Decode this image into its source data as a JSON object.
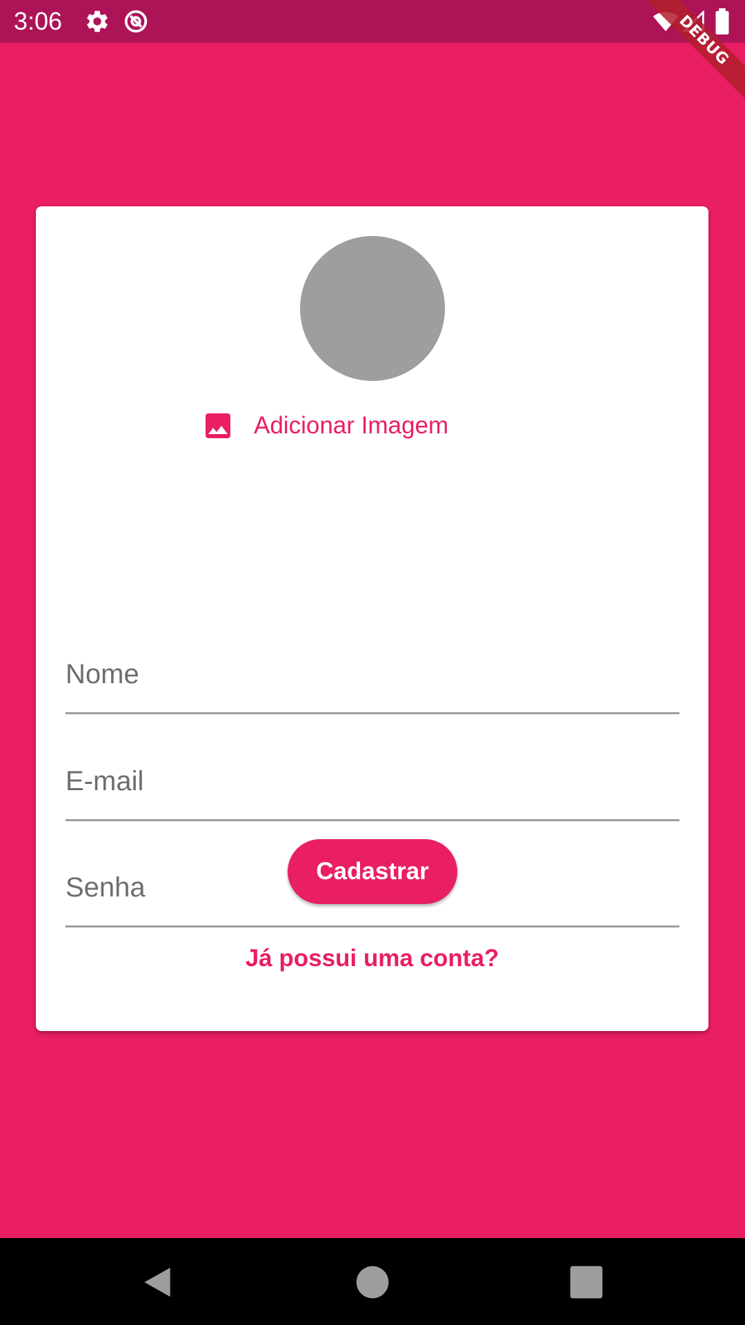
{
  "status_bar": {
    "time": "3:06",
    "icons": [
      "settings-icon",
      "at-sign-icon",
      "wifi-icon",
      "cell-signal-icon",
      "battery-icon"
    ]
  },
  "debug_banner": {
    "label": "DEBUG"
  },
  "colors": {
    "primary": "#E91E63",
    "status_bar": "#AD1457",
    "avatar_placeholder": "#9E9E9E",
    "card": "#FFFFFF"
  },
  "form": {
    "add_image_label": "Adicionar Imagem",
    "add_image_icon": "image-icon",
    "fields": {
      "name": {
        "placeholder": "Nome",
        "value": ""
      },
      "email": {
        "placeholder": "E-mail",
        "value": ""
      },
      "password": {
        "placeholder": "Senha",
        "value": ""
      }
    },
    "submit_label": "Cadastrar",
    "login_link": "Já possui uma conta?"
  },
  "nav_bar": {
    "icons": [
      "back-icon",
      "home-icon",
      "recents-icon"
    ]
  }
}
